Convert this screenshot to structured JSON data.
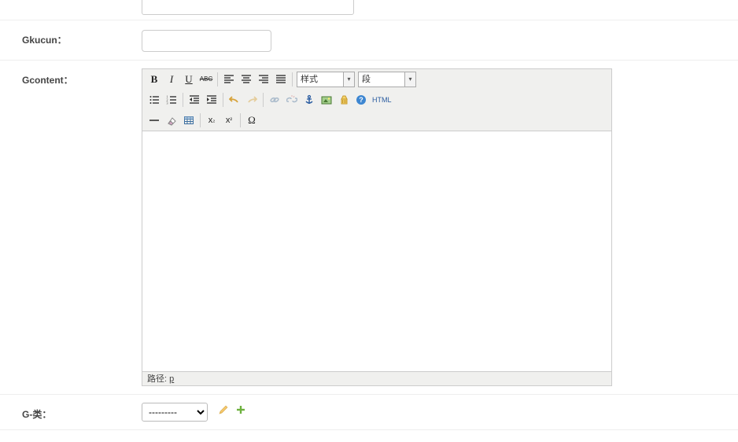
{
  "fields": {
    "top": {
      "label": ""
    },
    "gkucun": {
      "label": "Gkucun："
    },
    "gcontent": {
      "label": "Gcontent："
    },
    "gclass": {
      "label": "G-类："
    }
  },
  "editor": {
    "style_select": "样式",
    "para_select": "段",
    "path_label": "路径:",
    "path_value": "p",
    "html_btn": "HTML",
    "bold": "B",
    "italic": "I",
    "underline": "U",
    "strike": "ABC",
    "omega": "Ω",
    "sub": "x",
    "subs": "₂",
    "sup": "x",
    "sups": "²"
  },
  "gclass": {
    "selected": "---------"
  }
}
